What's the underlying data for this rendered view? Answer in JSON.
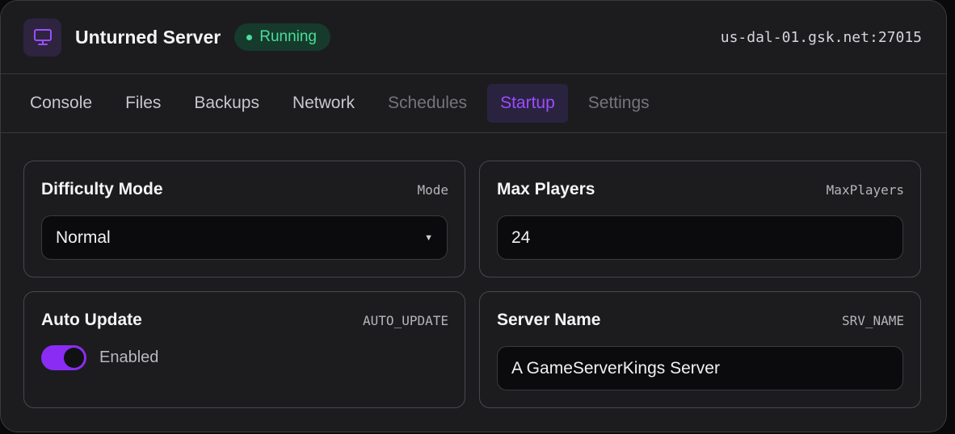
{
  "header": {
    "title": "Unturned Server",
    "status": "Running",
    "address": "us-dal-01.gsk.net:27015",
    "icon": "monitor-icon"
  },
  "tabs": [
    {
      "label": "Console"
    },
    {
      "label": "Files"
    },
    {
      "label": "Backups"
    },
    {
      "label": "Network"
    },
    {
      "label": "Schedules"
    },
    {
      "label": "Startup"
    },
    {
      "label": "Settings"
    }
  ],
  "active_tab": "Startup",
  "variables": {
    "difficulty": {
      "label": "Difficulty Mode",
      "key": "Mode",
      "value": "Normal"
    },
    "max_players": {
      "label": "Max Players",
      "key": "MaxPlayers",
      "value": "24"
    },
    "auto_update": {
      "label": "Auto Update",
      "key": "AUTO_UPDATE",
      "state": "Enabled",
      "enabled": true
    },
    "server_name": {
      "label": "Server Name",
      "key": "SRV_NAME",
      "value": "A GameServerKings Server"
    }
  },
  "colors": {
    "accent": "#8b2cf5",
    "running": "#4ade9a",
    "panel": "#1c1c1f"
  }
}
